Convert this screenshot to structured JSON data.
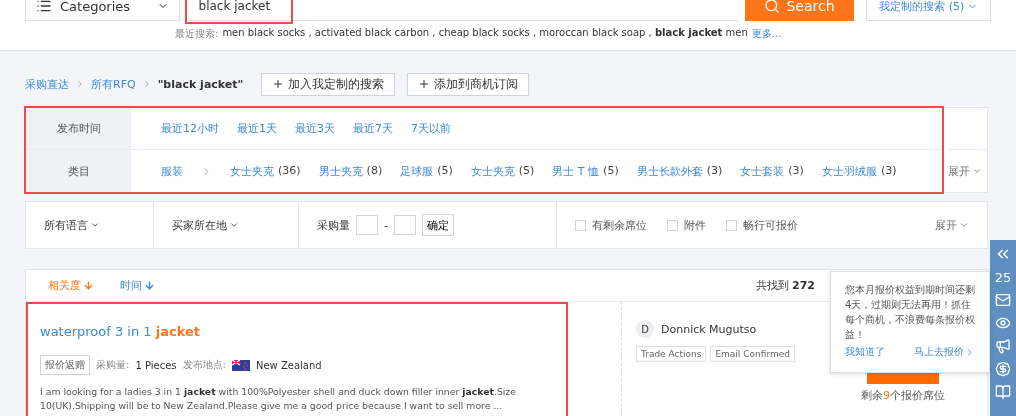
{
  "header": {
    "category_select": "Categories",
    "search": {
      "value": "black jacket",
      "highlighted": true
    },
    "search_button": "Search",
    "saved_searches": "我定制的搜索 (5)"
  },
  "recent_searches": {
    "label": "最近搜索:",
    "text": "men black socks , activated black carbon , cheap black socks , moroccan black soap , **black jacket** men",
    "more": "更多..."
  },
  "breadcrumb": {
    "items": [
      "采购直达",
      "所有RFQ"
    ],
    "current": "\"black jacket\""
  },
  "actions": [
    "加入我定制的搜索",
    "添加到商机订阅"
  ],
  "filters": {
    "highlighted": true,
    "expand": "展开",
    "rows": [
      {
        "label": "发布时间",
        "options": [
          {
            "text": "最近12小时"
          },
          {
            "text": "最近1天"
          },
          {
            "text": "最近3天"
          },
          {
            "text": "最近7天"
          },
          {
            "text": "7天以前"
          }
        ]
      },
      {
        "label": "类目",
        "root": "服装",
        "options": [
          {
            "text": "女士夹克",
            "count": "(36)"
          },
          {
            "text": "男士夹克",
            "count": "(8)"
          },
          {
            "text": "足球服",
            "count": "(5)"
          },
          {
            "text": "女士夹克",
            "count": "(5)"
          },
          {
            "text": "男士 T 恤",
            "count": "(5)"
          },
          {
            "text": "男士长款外套",
            "count": "(3)"
          },
          {
            "text": "女士套装",
            "count": "(3)"
          },
          {
            "text": "女士羽绒服",
            "count": "(3)"
          }
        ]
      }
    ]
  },
  "filter_bar": {
    "language": "所有语言",
    "location": "买家所在地",
    "quantity_label": "采购量",
    "quantity_separator": "-",
    "confirm": "确定",
    "checkboxes": [
      {
        "label": "有剩余席位",
        "checked": false
      },
      {
        "label": "附件",
        "checked": false
      },
      {
        "label": "畅行可报价",
        "checked": false
      }
    ],
    "expand": "展开"
  },
  "sort": {
    "tabs": [
      {
        "label": "相关度",
        "selected": true
      },
      {
        "label": "时间",
        "selected": false
      }
    ],
    "found_label": "共找到",
    "found_count": "272"
  },
  "results": [
    {
      "highlighted": true,
      "title": "waterproof 3 in 1 **jacket**",
      "tag": "报价返赠",
      "quantity_label": "采购量:",
      "quantity": "1 Pieces",
      "location_label": "发布地点:",
      "location": "New Zealand",
      "description": "I am looking for a ladies 3 in 1 **jacket** with 100%Polyester shell and duck down filler inner **jacket**.Size 10(UK).Shipping will be to New Zealand.Please give me a good price because I want to sell more ...",
      "buyer": {
        "initial": "D",
        "name": "Donnick Mugutso",
        "badges": [
          "Trade Actions",
          "Email Confirmed"
        ]
      },
      "quote_seats": "剩余**9**个报价席位"
    }
  ],
  "sidebar": {
    "count": "25"
  },
  "popover": {
    "message": "您本月报价权益到期时间还剩4天，过期则无法再用！抓住每个商机，不浪费每条报价权益！",
    "dismiss": "我知道了",
    "action": "马上去报价"
  }
}
